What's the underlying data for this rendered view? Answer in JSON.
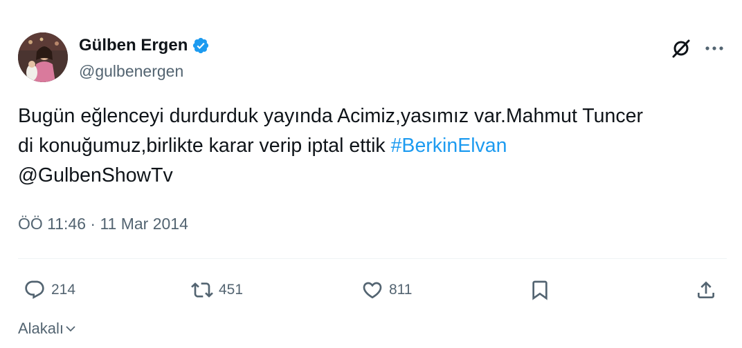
{
  "tweet": {
    "author": {
      "display_name": "Gülben Ergen",
      "handle": "@gulbenergen",
      "verified": true
    },
    "text_lines": [
      {
        "plain": "Bugün eğlenceyi durdurduk yayında Acimiz,yasımız var.Mahmut Tuncer",
        "hashtag": ""
      },
      {
        "plain": "di konuğumuz,birlikte karar verip iptal ettik ",
        "hashtag": "#BerkinElvan"
      },
      {
        "plain": "@GulbenShowTv",
        "hashtag": ""
      }
    ],
    "timestamp": "ÖÖ 11:46 · 11 Mar 2014"
  },
  "actions": {
    "reply_count": "214",
    "retweet_count": "451",
    "like_count": "811"
  },
  "sort": {
    "label": "Alakalı"
  },
  "colors": {
    "text": "#0f1419",
    "secondary": "#536471",
    "accent": "#1d9bf0",
    "divider": "#eff3f4"
  },
  "icons": [
    "verified-icon",
    "grok-icon",
    "more-icon",
    "reply-icon",
    "retweet-icon",
    "like-icon",
    "bookmark-icon",
    "share-icon",
    "chevron-down-icon"
  ]
}
